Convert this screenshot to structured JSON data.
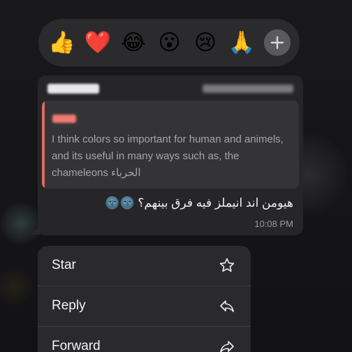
{
  "reactions": {
    "emojis": [
      "👍",
      "❤️",
      "😂",
      "😮",
      "😢",
      "🙏"
    ],
    "names": [
      "thumbs-up",
      "red-heart",
      "tears-of-joy",
      "surprised",
      "crying",
      "folded-hands"
    ],
    "add_icon": "plus-icon"
  },
  "message": {
    "quote": {
      "text": "I think colors so important for human and animels, and its useful in many ways such as, the chameleons الحرباء"
    },
    "body": "هيومن اند انيملز فيه فرق بينهم؟ 🌚🌚",
    "time": "10:08 PM"
  },
  "menu": {
    "items": [
      {
        "label": "Star",
        "icon": "star-icon"
      },
      {
        "label": "Reply",
        "icon": "reply-icon"
      },
      {
        "label": "Forward",
        "icon": "forward-icon"
      }
    ]
  },
  "colors": {
    "bubble": "#262628",
    "quote_accent": "#e06a63",
    "menu_bg": "#2a2a2c"
  }
}
